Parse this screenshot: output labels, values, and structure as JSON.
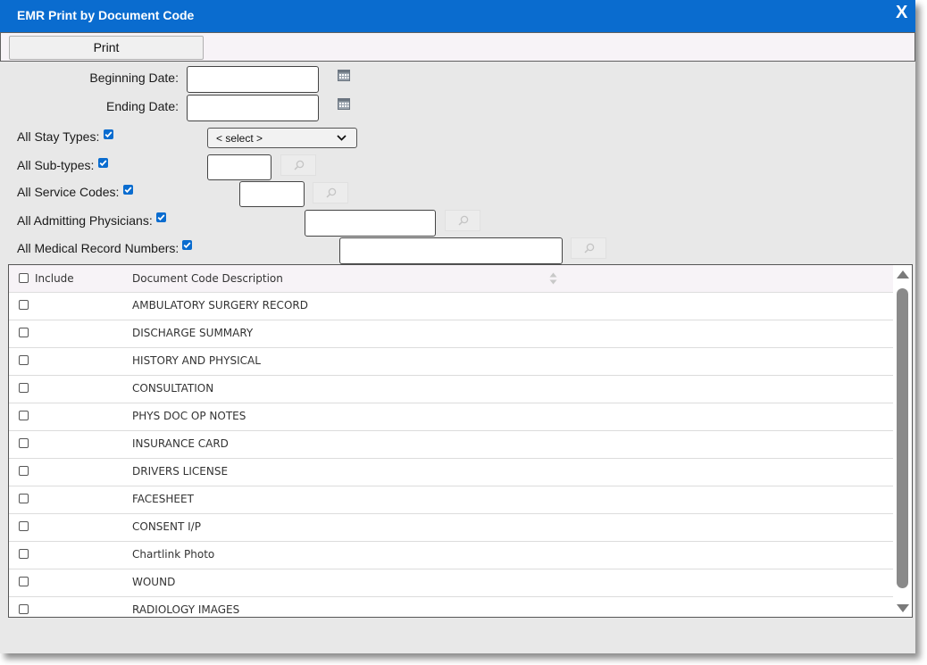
{
  "window": {
    "title": "EMR Print by Document Code",
    "close_label": "X"
  },
  "toolbar": {
    "print_label": "Print"
  },
  "form": {
    "beginning_date_label": "Beginning Date:",
    "beginning_date_value": "",
    "ending_date_label": "Ending Date:",
    "ending_date_value": "",
    "stay_types_label": "All Stay Types:",
    "stay_types_checked": true,
    "stay_type_select_value": "< select >",
    "sub_types_label": "All Sub-types:",
    "sub_types_checked": true,
    "service_codes_label": "All Service Codes:",
    "service_codes_checked": true,
    "admitting_physicians_label": "All Admitting Physicians:",
    "admitting_physicians_checked": true,
    "medical_record_numbers_label": "All Medical Record Numbers:",
    "medical_record_numbers_checked": true,
    "icons": [
      "calendar-icon",
      "magnifier-icon",
      "chevron-down-icon",
      "checkbox-icon"
    ]
  },
  "grid": {
    "columns": [
      "Include",
      "Document Code Description"
    ],
    "rows": [
      {
        "description": "AMBULATORY SURGERY RECORD",
        "include": false
      },
      {
        "description": "DISCHARGE SUMMARY",
        "include": false
      },
      {
        "description": "HISTORY AND PHYSICAL",
        "include": false
      },
      {
        "description": "CONSULTATION",
        "include": false
      },
      {
        "description": "PHYS DOC OP NOTES",
        "include": false
      },
      {
        "description": "INSURANCE CARD",
        "include": false
      },
      {
        "description": "DRIVERS LICENSE",
        "include": false
      },
      {
        "description": "FACESHEET",
        "include": false
      },
      {
        "description": "CONSENT I/P",
        "include": false
      },
      {
        "description": "Chartlink Photo",
        "include": false
      },
      {
        "description": "WOUND",
        "include": false
      },
      {
        "description": "RADIOLOGY IMAGES",
        "include": false
      }
    ]
  },
  "colors": {
    "titlebar": "#0a6ccf",
    "checkbox_checked": "#0a6ccf",
    "dialog_bg": "#e8e8e8"
  }
}
